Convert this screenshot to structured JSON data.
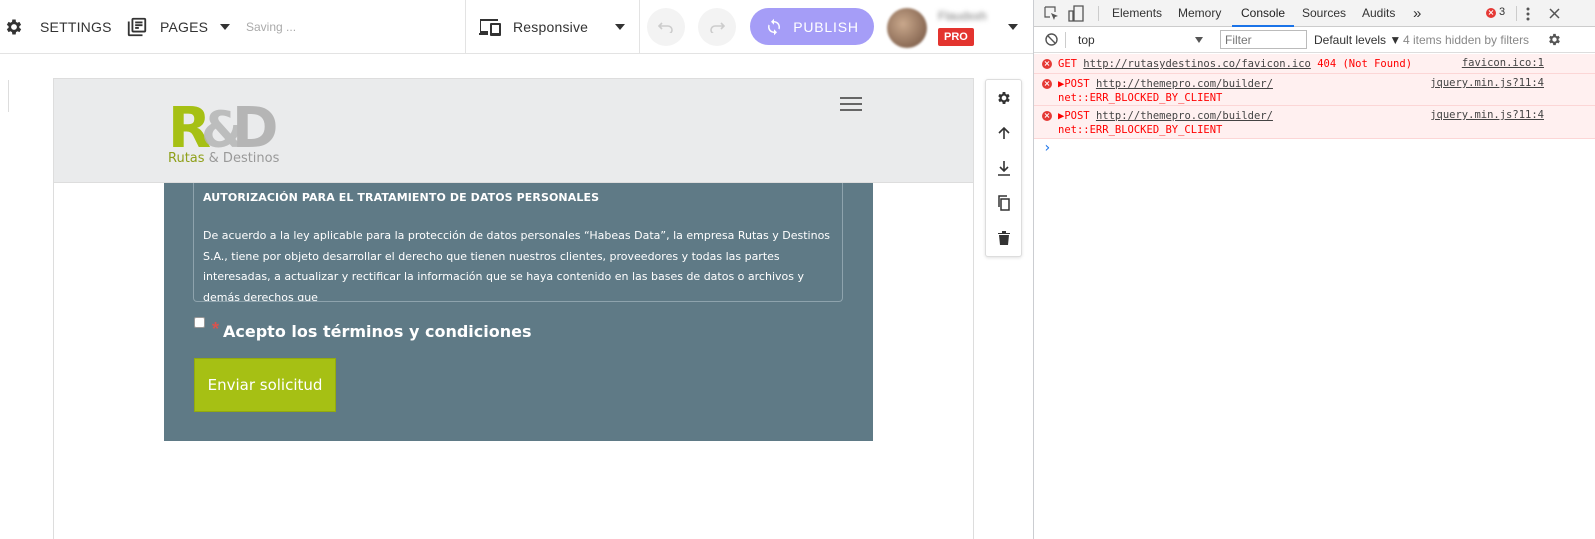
{
  "topbar": {
    "settings_label": "SETTINGS",
    "pages_label": "PAGES",
    "status": "Saving ...",
    "device_label": "Responsive",
    "publish_label": "PUBLISH",
    "user_name": "Flaudxxh",
    "plan_badge": "PRO"
  },
  "site": {
    "logo_text": "R&D",
    "logo_tag_part1": "Rutas",
    "logo_tag_part2": " & Destinos",
    "terms_title": "AUTORIZACIÓN PARA EL TRATAMIENTO DE DATOS PERSONALES",
    "terms_body": "De acuerdo a la ley aplicable para la protección de datos personales “Habeas Data”, la empresa Rutas y Destinos S.A., tiene por objeto desarrollar el derecho que tienen nuestros clientes, proveedores y todas las partes interesadas, a actualizar y rectificar la información que se haya contenido en las bases de datos o archivos y demás derechos que",
    "required_mark": "*",
    "accept_label": "Acepto los términos y condiciones",
    "submit_label": "Enviar solicitud"
  },
  "devtools": {
    "tabs": [
      "Elements",
      "Memory",
      "Console",
      "Sources",
      "Audits"
    ],
    "more_tabs": "»",
    "error_count": "3",
    "context": "top",
    "filter_placeholder": "Filter",
    "levels": "Default levels ▼",
    "hidden_note": "4 items hidden by filters",
    "messages": [
      {
        "method": "GET",
        "url": "http://rutasydestinos.co/favicon.ico",
        "status": "404 (Not Found)",
        "source": "favicon.ico:1"
      },
      {
        "method": "▶POST",
        "url": "http://themepro.com/builder/",
        "status": "net::ERR_BLOCKED_BY_CLIENT",
        "source": "jquery.min.js?11:4"
      },
      {
        "method": "▶POST",
        "url": "http://themepro.com/builder/",
        "status": "net::ERR_BLOCKED_BY_CLIENT",
        "source": "jquery.min.js?11:4"
      }
    ],
    "prompt": "›"
  },
  "colors": {
    "publish": "#a59df7",
    "form_bg": "#5f7a86",
    "submit": "#a6c014",
    "logo_green": "#a6c014",
    "logo_gray": "#b5b5b5",
    "pro_badge": "#e3342f",
    "error_text": "#ff0000"
  },
  "icons": [
    "gear-icon",
    "pages-icon",
    "caret-down-icon",
    "devices-icon",
    "undo-icon",
    "redo-icon",
    "sync-icon",
    "hamburger-icon",
    "arrow-up-icon",
    "download-icon",
    "copy-icon",
    "trash-icon",
    "inspect-icon",
    "device-toolbar-icon",
    "clear-console-icon",
    "kebab-icon",
    "close-icon",
    "error-icon"
  ]
}
